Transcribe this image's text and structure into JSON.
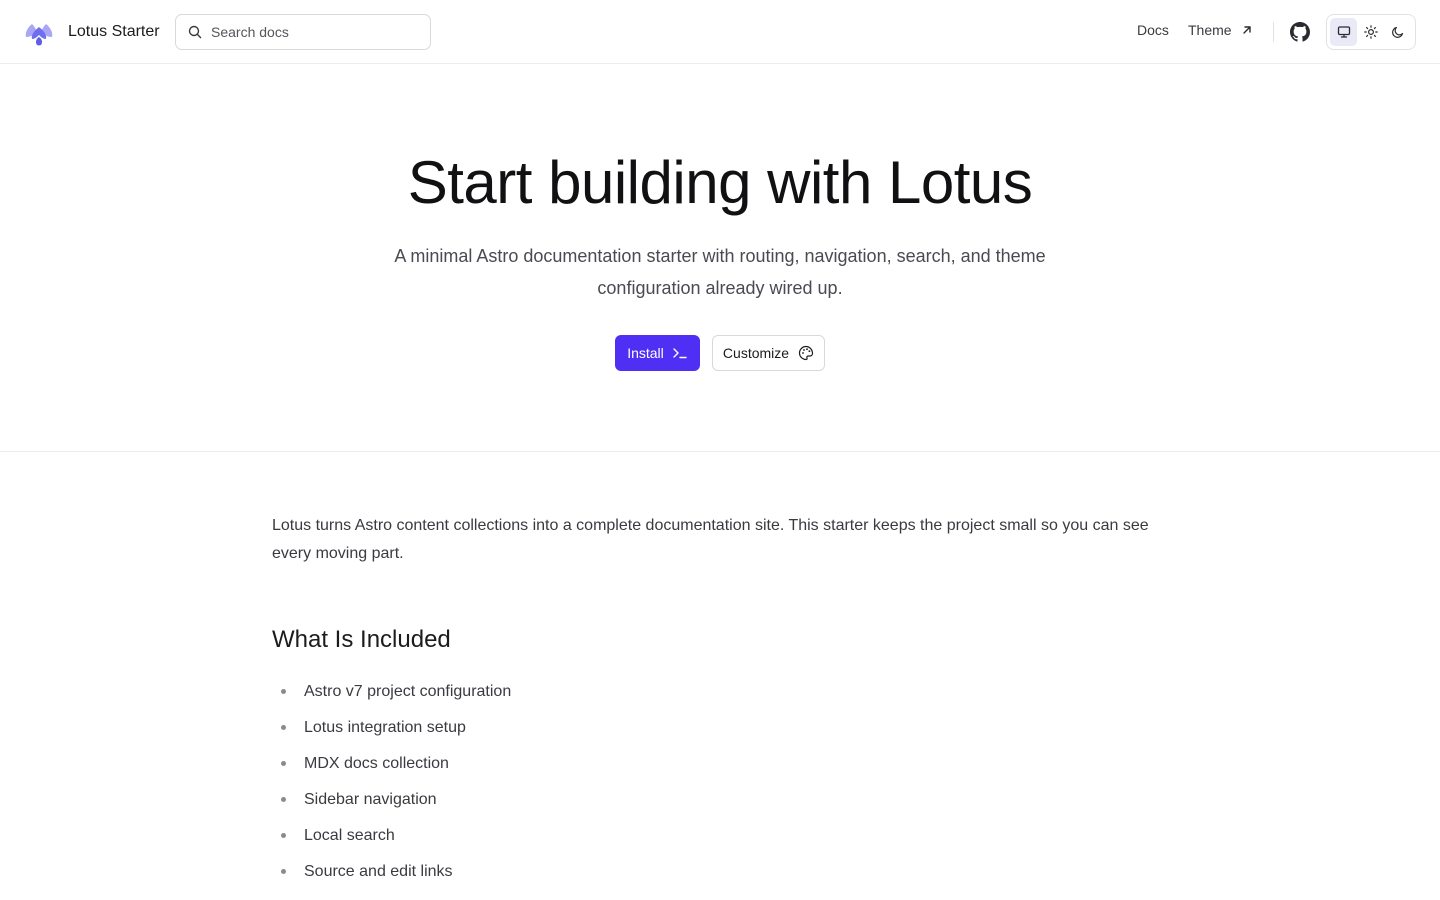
{
  "header": {
    "site_title": "Lotus Starter",
    "search_placeholder": "Search docs",
    "nav": {
      "docs_label": "Docs",
      "theme_label": "Theme"
    },
    "theme_switch": {
      "options": [
        "system",
        "light",
        "dark"
      ],
      "selected": "system"
    }
  },
  "hero": {
    "title": "Start building with Lotus",
    "subtitle": "A minimal Astro documentation starter with routing, navigation, search, and theme configuration already wired up.",
    "install_label": "Install",
    "customize_label": "Customize"
  },
  "content": {
    "intro": "Lotus turns Astro content collections into a complete documentation site. This starter keeps the project small so you can see every moving part.",
    "section_heading": "What Is Included",
    "features": [
      "Astro v7 project configuration",
      "Lotus integration setup",
      "MDX docs collection",
      "Sidebar navigation",
      "Local search",
      "Source and edit links"
    ]
  },
  "colors": {
    "accent": "#4f2ff3",
    "logo_primary": "#6d6ef0",
    "logo_secondary": "#a9a6f6",
    "active_toggle_bg": "#e9e9f7"
  },
  "icons": {
    "logo": "lotus-logo-icon",
    "search": "search-icon",
    "external": "arrow-up-right-icon",
    "github": "github-icon",
    "system": "monitor-icon",
    "light": "sun-icon",
    "dark": "moon-icon",
    "install": "terminal-icon",
    "customize": "palette-icon"
  }
}
